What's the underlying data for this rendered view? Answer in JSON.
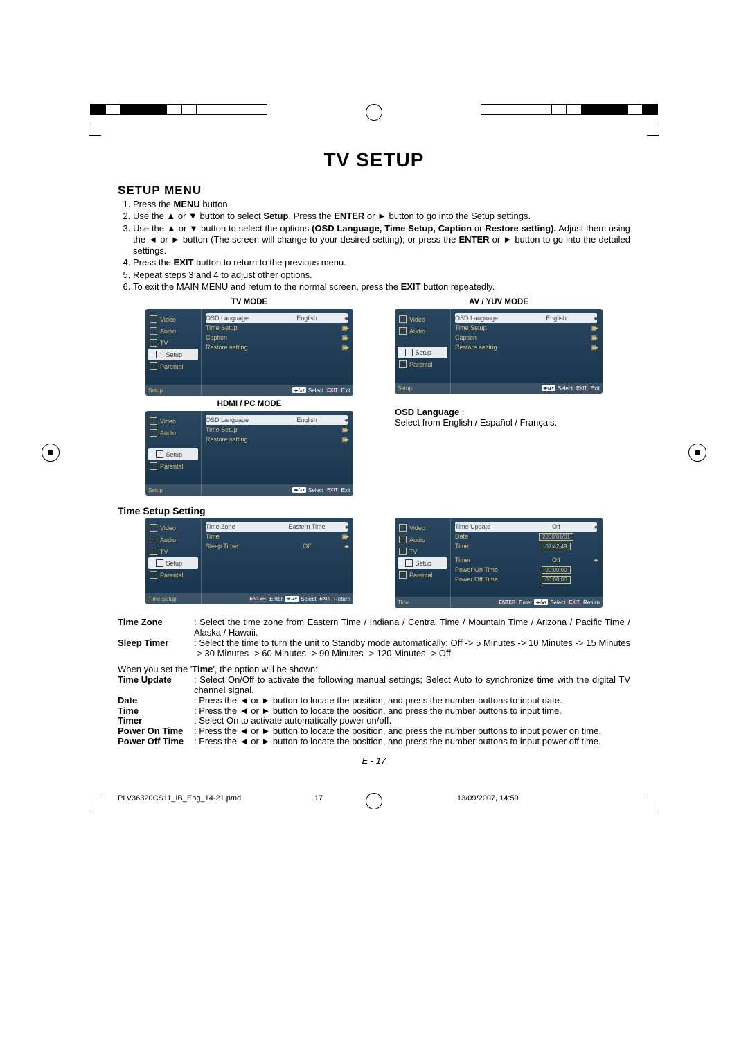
{
  "title": "TV SETUP",
  "section_heading": "SETUP MENU",
  "steps": {
    "s1_a": "Press the ",
    "s1_b": "MENU",
    "s1_c": " button.",
    "s2_a": "Use the ▲ or ▼ button to select ",
    "s2_b": "Setup",
    "s2_c": ". Press the ",
    "s2_d": "ENTER",
    "s2_e": " or ► button to go into the Setup settings.",
    "s3_a": "Use the ▲ or ▼ button to select the options ",
    "s3_b": "(OSD Language, Time Setup, Caption",
    "s3_c": " or ",
    "s3_d": "Restore setting).",
    "s3_e": " Adjust them using the ◄ or ► button (The screen will change to your desired setting); or press the ",
    "s3_f": "ENTER",
    "s3_g": " or ► button to go into the detailed settings.",
    "s4_a": "Press the ",
    "s4_b": "EXIT",
    "s4_c": " button to return to the previous menu.",
    "s5": "Repeat steps 3 and 4 to adjust other options.",
    "s6_a": "To exit the MAIN MENU and return to the normal screen, press the ",
    "s6_b": "EXIT",
    "s6_c": " button repeatedly."
  },
  "mode_labels": {
    "tv": "TV MODE",
    "av": "AV / YUV MODE",
    "hdmi": "HDMI / PC MODE"
  },
  "side_items": {
    "video": "Video",
    "audio": "Audio",
    "tv": "TV",
    "setup": "Setup",
    "parental": "Parental"
  },
  "setup_rows": {
    "osd_lang": "OSD Language",
    "time_setup": "Time Setup",
    "caption": "Caption",
    "restore": "Restore setting",
    "english": "English"
  },
  "footer_hints": {
    "setup": "Setup",
    "timesetup": "Time Setup",
    "time": "Time",
    "select": "Select",
    "exit": "EXIT",
    "exit2": "Exit",
    "enter": "ENTER",
    "enter2": "Enter",
    "return": "Return"
  },
  "osd_lang_heading": "OSD Language",
  "osd_lang_desc": "Select from English / Español / Français.",
  "time_setup_heading": "Time Setup Setting",
  "time_panel": {
    "time_zone": "Time Zone",
    "time": "Time",
    "sleep_timer": "Sleep Timer",
    "eastern": "Eastern Time",
    "off": "Off"
  },
  "time_panel2": {
    "time_update": "Time Update",
    "date": "Date",
    "time": "Time",
    "timer": "Timer",
    "power_on": "Power On Time",
    "power_off": "Power Off Time",
    "off": "Off",
    "date_val": "2000/01/01",
    "time_val": "07:42:49",
    "zero_time": "00:00:00"
  },
  "defs": {
    "time_zone_t": "Time Zone",
    "time_zone_d": ": Select the time zone from Eastern Time / Indiana / Central Time / Mountain Time / Arizona / Pacific Time / Alaska / Hawaii.",
    "sleep_timer_t": "Sleep Timer",
    "sleep_timer_d": ": Select the time to turn the unit to Standby mode automatically: Off -> 5 Minutes -> 10 Minutes -> 15 Minutes -> 30 Minutes -> 60 Minutes -> 90 Minutes -> 120 Minutes  -> Off.",
    "when_time_a": "When you set the '",
    "when_time_b": "Time",
    "when_time_c": "', the option will be shown:",
    "time_update_t": "Time Update",
    "time_update_d": ": Select On/Off to activate the following manual settings; Select Auto to synchronize time with the digital TV channel signal.",
    "date_t": "Date",
    "date_d": ": Press the ◄ or ► button to locate the position, and press the number buttons to input date.",
    "time_t": "Time",
    "time_d": ": Press the ◄ or ► button to locate the position, and press the number buttons to input time.",
    "timer_t": "Timer",
    "timer_d": ": Select On to activate automatically power on/off.",
    "pon_t": "Power On Time",
    "pon_d": ": Press the ◄ or ► button to locate the position, and press the number buttons to input power on time.",
    "poff_t": "Power Off Time",
    "poff_d": ": Press the ◄ or ► button to locate the position, and press the number buttons to input power off time."
  },
  "colon": " :",
  "pagenum": "E - 17",
  "footer": {
    "file": "PLV36320CS11_IB_Eng_14-21.pmd",
    "page": "17",
    "date": "13/09/2007, 14:59"
  }
}
